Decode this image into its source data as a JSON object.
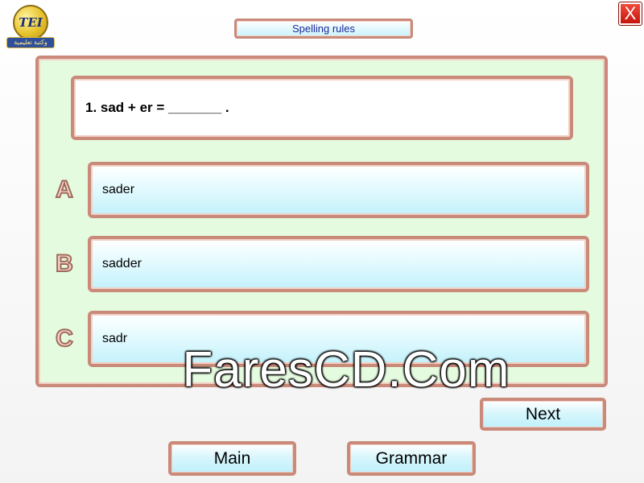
{
  "header": {
    "title": "Spelling rules",
    "close_label": "X",
    "logo_text": "TEI",
    "logo_band_text": "وكتبة تعليمية"
  },
  "question": {
    "text": "1. sad + er = _______ ."
  },
  "options": [
    {
      "letter": "A",
      "text": "sader"
    },
    {
      "letter": "B",
      "text": "sadder"
    },
    {
      "letter": "C",
      "text": "sadr"
    }
  ],
  "buttons": {
    "next": "Next",
    "main": "Main",
    "grammar": "Grammar"
  },
  "watermark": "FaresCD.Com",
  "colors": {
    "panel_bg": "#e5fbe0",
    "border": "#c98a7a",
    "button_fill": "#c3f1fb",
    "title_text": "#1d2a9a",
    "close_bg": "#d9251a"
  }
}
